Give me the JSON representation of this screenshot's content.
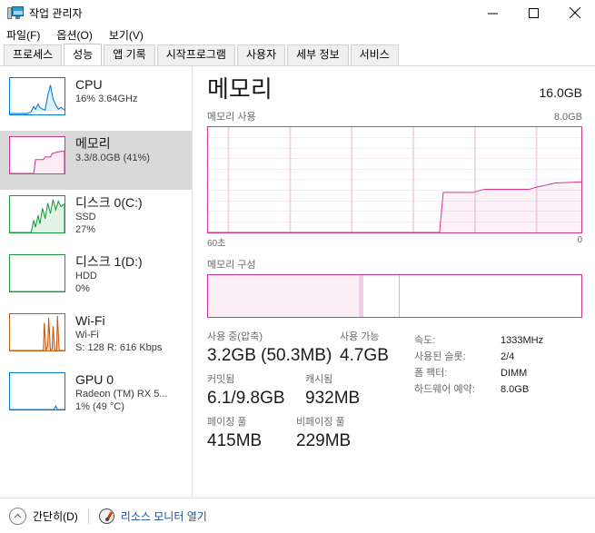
{
  "window": {
    "title": "작업 관리자",
    "icon": "task-manager-icon",
    "minimize_label": "−",
    "maximize_label": "□",
    "close_label": "✕"
  },
  "menu": {
    "items": [
      {
        "label": "파일(F)",
        "name": "menu-file"
      },
      {
        "label": "옵션(O)",
        "name": "menu-options"
      },
      {
        "label": "보기(V)",
        "name": "menu-view"
      }
    ]
  },
  "tabs": [
    {
      "label": "프로세스",
      "active": false
    },
    {
      "label": "성능",
      "active": true
    },
    {
      "label": "앱 기록",
      "active": false
    },
    {
      "label": "시작프로그램",
      "active": false
    },
    {
      "label": "사용자",
      "active": false
    },
    {
      "label": "세부 정보",
      "active": false
    },
    {
      "label": "서비스",
      "active": false
    }
  ],
  "sidebar": {
    "items": [
      {
        "name": "cpu",
        "title": "CPU",
        "sub1": "16% 3.64GHz",
        "sub2": "",
        "color": "#0078d7",
        "selected": false
      },
      {
        "name": "memory",
        "title": "메모리",
        "sub1": "3.3/8.0GB (41%)",
        "sub2": "",
        "color": "#d4368c",
        "selected": true
      },
      {
        "name": "disk-0",
        "title": "디스크 0(C:)",
        "sub1": "SSD",
        "sub2": "27%",
        "color": "#1a9a3c",
        "selected": false
      },
      {
        "name": "disk-1",
        "title": "디스크 1(D:)",
        "sub1": "HDD",
        "sub2": "0%",
        "color": "#1a9a3c",
        "selected": false
      },
      {
        "name": "wifi",
        "title": "Wi-Fi",
        "sub1": "Wi-Fi",
        "sub2": "S: 128 R: 616 Kbps",
        "color": "#c55a11",
        "selected": false
      },
      {
        "name": "gpu-0",
        "title": "GPU 0",
        "sub1": "Radeon (TM) RX 5...",
        "sub2": "1% (49 °C)",
        "color": "#0078d7",
        "selected": false
      }
    ]
  },
  "main": {
    "title": "메모리",
    "total": "16.0GB",
    "graph_caption": "메모리 사용",
    "graph_max": "8.0GB",
    "axis_left": "60초",
    "axis_right": "0",
    "composition_caption": "메모리 구성",
    "accent_color": "#d4368c"
  },
  "chart_data": {
    "type": "area",
    "title": "메모리 사용",
    "xlabel": "",
    "ylabel": "",
    "ylim": [
      0,
      8.0
    ],
    "y_unit": "GB",
    "y_max_label": "8.0GB",
    "x_start_label": "60초",
    "x_end_label": "0",
    "grid": true,
    "grid_rows": 10,
    "grid_cols": 6,
    "series": [
      {
        "name": "메모리 사용",
        "points_percent": [
          [
            0,
            0
          ],
          [
            60,
            0
          ],
          [
            61,
            0
          ],
          [
            62,
            0
          ],
          [
            63,
            38
          ],
          [
            68,
            38
          ],
          [
            71,
            38
          ],
          [
            74,
            41
          ],
          [
            80,
            41
          ],
          [
            86,
            41
          ],
          [
            88,
            43
          ],
          [
            93,
            47
          ],
          [
            100,
            48
          ]
        ]
      }
    ],
    "composition": {
      "type": "bar",
      "segments": [
        {
          "name": "사용 중",
          "percent_start": 0,
          "percent_end": 40.5,
          "fill": "#fbeef5"
        },
        {
          "name": "수정됨",
          "percent_start": 40.5,
          "percent_end": 41.5,
          "fill": "#f3cde3"
        },
        {
          "name": "대기",
          "percent_start": 41.5,
          "percent_end": 51.0,
          "fill": "#ffffff"
        },
        {
          "name": "사용 가능",
          "percent_start": 51.0,
          "percent_end": 100,
          "fill": "#ffffff"
        }
      ]
    }
  },
  "stats": {
    "in_use_label": "사용 중(압축)",
    "in_use_value": "3.2GB (50.3MB)",
    "available_label": "사용 가능",
    "available_value": "4.7GB",
    "committed_label": "커밋됨",
    "committed_value": "6.1/9.8GB",
    "cached_label": "캐시됨",
    "cached_value": "932MB",
    "paged_pool_label": "페이징 풀",
    "paged_pool_value": "415MB",
    "nonpaged_pool_label": "비페이징 풀",
    "nonpaged_pool_value": "229MB"
  },
  "specs": [
    {
      "key": "속도:",
      "value": "1333MHz",
      "name": "speed"
    },
    {
      "key": "사용된 슬롯:",
      "value": "2/4",
      "name": "slots-used"
    },
    {
      "key": "폼 팩터:",
      "value": "DIMM",
      "name": "form-factor"
    },
    {
      "key": "하드웨어 예약:",
      "value": "8.0GB",
      "name": "hardware-reserved"
    }
  ],
  "statusbar": {
    "fewer_details": "간단히(D)",
    "resource_monitor": "리소스 모니터 열기"
  }
}
